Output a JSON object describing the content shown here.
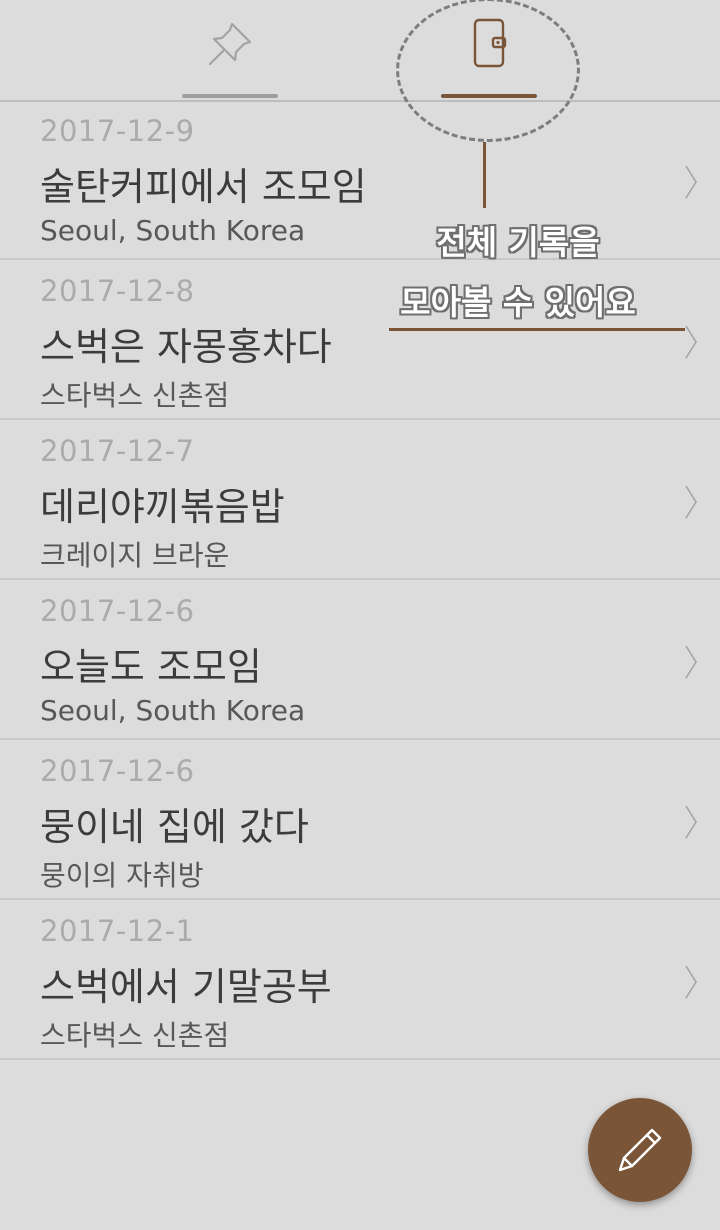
{
  "tabs": [
    {
      "name": "pins",
      "icon": "pushpin-icon",
      "selected": false
    },
    {
      "name": "all-records",
      "icon": "notebook-icon",
      "selected": true
    }
  ],
  "entries": [
    {
      "date": "2017-12-9",
      "title": "술탄커피에서 조모임",
      "location": "Seoul, South Korea"
    },
    {
      "date": "2017-12-8",
      "title": "스벅은 자몽홍차다",
      "location": "스타벅스 신촌점"
    },
    {
      "date": "2017-12-7",
      "title": "데리야끼볶음밥",
      "location": "크레이지 브라운"
    },
    {
      "date": "2017-12-6",
      "title": "오늘도 조모임",
      "location": "Seoul, South Korea"
    },
    {
      "date": "2017-12-6",
      "title": "뭉이네 집에 갔다",
      "location": "뭉이의 자취방"
    },
    {
      "date": "2017-12-1",
      "title": "스벅에서 기말공부",
      "location": "스타벅스 신촌점"
    }
  ],
  "callout": {
    "line1": "전체 기록을",
    "line2": "모아볼 수 있어요"
  },
  "fab": {
    "icon": "pencil-icon"
  },
  "colors": {
    "accent": "#7a5538",
    "background": "#dcdcdc"
  }
}
